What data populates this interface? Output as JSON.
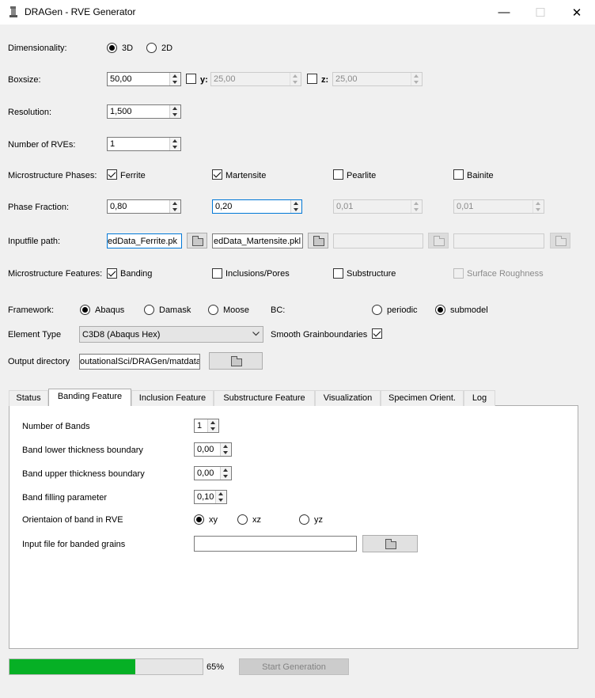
{
  "window": {
    "title": "DRAGen - RVE Generator",
    "minimize": "—",
    "maximize": "☐",
    "close": "✕"
  },
  "dimensionality": {
    "label": "Dimensionality:",
    "opt3d": "3D",
    "opt2d": "2D",
    "selected": "3D"
  },
  "boxsize": {
    "label": "Boxsize:",
    "value": "50,00",
    "y_label": "y:",
    "y_value": "25,00",
    "z_label": "z:",
    "z_value": "25,00"
  },
  "resolution": {
    "label": "Resolution:",
    "value": "1,500"
  },
  "num_rves": {
    "label": "Number of RVEs:",
    "value": "1"
  },
  "phases": {
    "label": "Microstructure Phases:",
    "items": [
      {
        "name": "Ferrite",
        "checked": true
      },
      {
        "name": "Martensite",
        "checked": true
      },
      {
        "name": "Pearlite",
        "checked": false
      },
      {
        "name": "Bainite",
        "checked": false
      }
    ]
  },
  "phase_fraction": {
    "label": "Phase Fraction:",
    "values": [
      "0,80",
      "0,20",
      "0,01",
      "0,01"
    ]
  },
  "inputfile": {
    "label": "Inputfile path:",
    "paths": [
      "edData_Ferrite.pk",
      "edData_Martensite.pkl",
      "",
      ""
    ]
  },
  "features": {
    "label": "Microstructure Features:",
    "items": [
      {
        "name": "Banding",
        "checked": true
      },
      {
        "name": "Inclusions/Pores",
        "checked": false
      },
      {
        "name": "Substructure",
        "checked": false
      },
      {
        "name": "Surface Roughness",
        "checked": false
      }
    ]
  },
  "framework": {
    "label": "Framework:",
    "options": [
      "Abaqus",
      "Damask",
      "Moose"
    ],
    "selected": "Abaqus"
  },
  "bc": {
    "label": "BC:",
    "options": [
      "periodic",
      "submodel"
    ],
    "selected": "submodel"
  },
  "element_type": {
    "label": "Element Type",
    "value": "C3D8 (Abaqus Hex)"
  },
  "smooth": {
    "label": "Smooth Grainboundaries",
    "checked": true
  },
  "output": {
    "label": "Output directory",
    "value": "outationalSci/DRAGen/matdata"
  },
  "tabs": [
    "Status",
    "Banding Feature",
    "Inclusion Feature",
    "Substructure Feature",
    "Visualization",
    "Specimen Orient.",
    "Log"
  ],
  "active_tab": "Banding Feature",
  "banding": {
    "num_bands_label": "Number of Bands",
    "num_bands": "1",
    "lower_label": "Band lower thickness boundary",
    "lower": "0,00",
    "upper_label": "Band upper thickness boundary",
    "upper": "0,00",
    "filling_label": "Band filling parameter",
    "filling": "0,10",
    "orientation_label": "Orientaion of band in RVE",
    "orientation_options": [
      "xy",
      "xz",
      "yz"
    ],
    "orientation_selected": "xy",
    "input_label": "Input file for banded grains",
    "input_value": ""
  },
  "progress": {
    "value": 0.65,
    "text": "65%"
  },
  "start_button": "Start Generation",
  "colors": {
    "progress_fill": "#06b025",
    "focus": "#0078d7"
  }
}
